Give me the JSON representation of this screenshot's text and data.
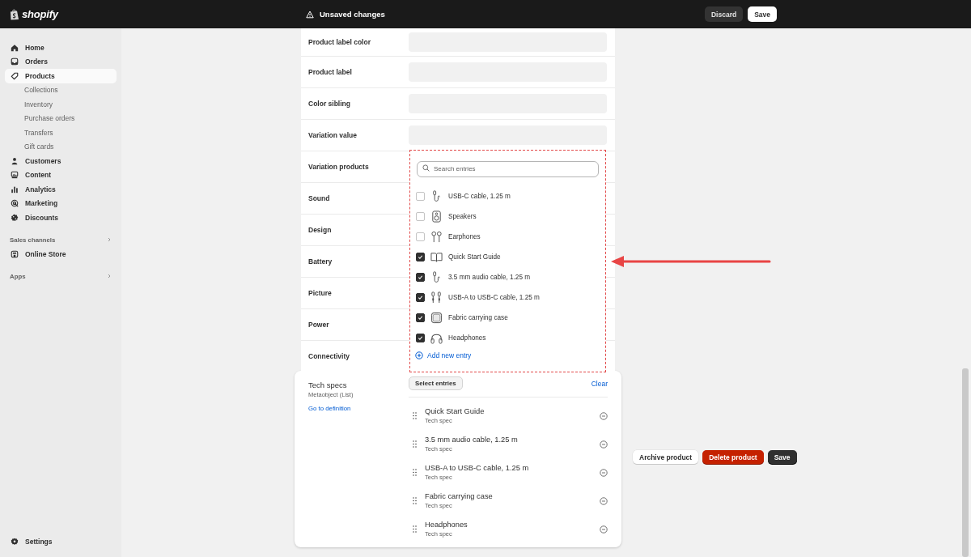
{
  "top_bar": {
    "logo": "shopify",
    "title": "Unsaved changes",
    "buttons": [
      {
        "label": "Discard",
        "kind": "secondary"
      },
      {
        "label": "Save",
        "kind": "primary"
      }
    ]
  },
  "sidebar": {
    "sections": [
      {
        "items": [
          {
            "label": "Home",
            "kind": "home",
            "selected": false
          },
          {
            "label": "Orders",
            "kind": "orders",
            "selected": false
          },
          {
            "label": "Products",
            "kind": "products",
            "selected": true,
            "children": [
              {
                "label": "Collections",
                "selected": false
              },
              {
                "label": "Inventory",
                "selected": false
              },
              {
                "label": "Purchase orders",
                "selected": false
              },
              {
                "label": "Transfers",
                "selected": false
              },
              {
                "label": "Gift cards",
                "selected": false
              }
            ]
          },
          {
            "label": "Customers",
            "kind": "customers",
            "selected": false
          },
          {
            "label": "Content",
            "kind": "content",
            "selected": false
          },
          {
            "label": "Analytics",
            "kind": "analytics",
            "selected": false
          },
          {
            "label": "Marketing",
            "kind": "marketing",
            "selected": false
          },
          {
            "label": "Discounts",
            "kind": "discounts",
            "selected": false
          }
        ]
      },
      {
        "heading": "Sales channels",
        "items": [
          {
            "label": "Online Store",
            "kind": "store",
            "selected": false
          }
        ]
      },
      {
        "heading": "Apps"
      }
    ],
    "settings": {
      "label": "Settings"
    }
  },
  "fields": [
    {
      "label": "Product label color",
      "kind": "input"
    },
    {
      "label": "Product label",
      "kind": "input"
    },
    {
      "label": "Color sibling",
      "kind": "input"
    },
    {
      "label": "Variation value",
      "kind": "input"
    },
    {
      "label": "Variation products",
      "kind": "plain"
    },
    {
      "label": "Sound",
      "kind": "plain"
    },
    {
      "label": "Design",
      "kind": "plain"
    },
    {
      "label": "Battery",
      "kind": "plain"
    },
    {
      "label": "Picture",
      "kind": "plain"
    },
    {
      "label": "Power",
      "kind": "plain"
    },
    {
      "label": "Connectivity",
      "kind": "plain"
    }
  ],
  "entry_picker": {
    "search": {
      "placeholder": "Search entries"
    },
    "entries": [
      {
        "label": "USB-C cable, 1.25 m",
        "kind": "cable",
        "checked": false
      },
      {
        "label": "Speakers",
        "kind": "speaker",
        "checked": false
      },
      {
        "label": "Earphones",
        "kind": "earphones",
        "checked": false
      },
      {
        "label": "Quick Start Guide",
        "kind": "book",
        "checked": true
      },
      {
        "label": "3.5 mm audio cable, 1.25 m",
        "kind": "cable",
        "checked": true
      },
      {
        "label": "USB-A to USB-C cable, 1.25 m",
        "kind": "double-cable",
        "checked": true
      },
      {
        "label": "Fabric carrying case",
        "kind": "case",
        "checked": true
      },
      {
        "label": "Headphones",
        "kind": "headphones",
        "checked": true
      }
    ],
    "add_link": "Add new entry"
  },
  "tech_specs": {
    "title": "Tech specs",
    "type": "Metaobject (List)",
    "link": "Go to definition",
    "select_button": "Select entries",
    "clear": "Clear",
    "items": [
      {
        "title": "Quick Start Guide",
        "subtitle": "Tech spec"
      },
      {
        "title": "3.5 mm audio cable, 1.25 m",
        "subtitle": "Tech spec"
      },
      {
        "title": "USB-A to USB-C cable, 1.25 m",
        "subtitle": "Tech spec"
      },
      {
        "title": "Fabric carrying case",
        "subtitle": "Tech spec"
      },
      {
        "title": "Headphones",
        "subtitle": "Tech spec"
      }
    ]
  },
  "actions": [
    {
      "label": "Archive product",
      "kind": "secondary"
    },
    {
      "label": "Delete product",
      "kind": "critical"
    },
    {
      "label": "Save",
      "kind": "primary"
    }
  ]
}
